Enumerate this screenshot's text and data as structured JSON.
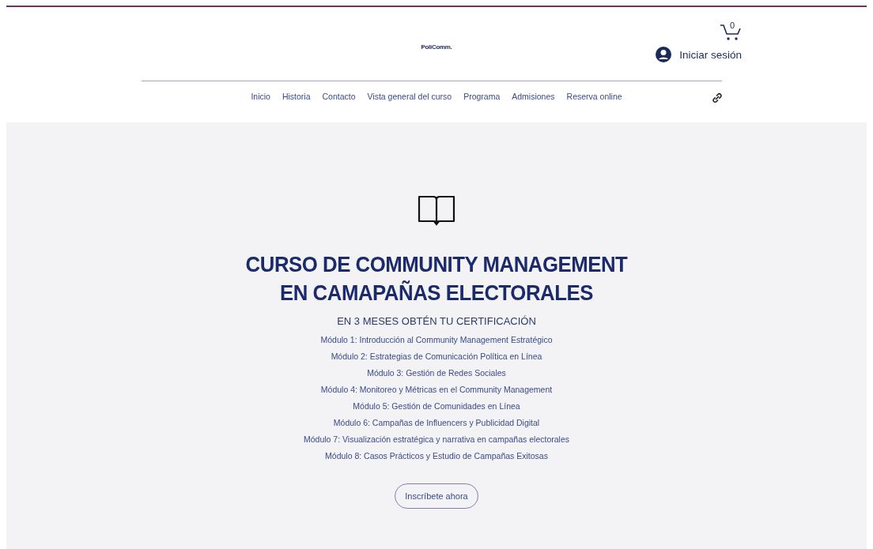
{
  "header": {
    "logo": "PoliComm.",
    "cart_count": "0",
    "login": "Iniciar sesión"
  },
  "nav": [
    {
      "label": "Inicio"
    },
    {
      "label": "Historia"
    },
    {
      "label": "Contacto"
    },
    {
      "label": "Vista general del curso"
    },
    {
      "label": "Programa"
    },
    {
      "label": "Admisiones"
    },
    {
      "label": "Reserva online"
    }
  ],
  "hero": {
    "title": "CURSO DE COMMUNITY MANAGEMENT EN CAMAPAÑAS ELECTORALES",
    "subtitle": "EN 3 MESES OBTÉN TU CERTIFICACIÓN",
    "modules": [
      "Módulo 1: Introducción al Community Management Estratégico",
      "Módulo 2: Estrategias de Comunicación Política en Línea",
      "Módulo 3: Gestión de Redes Sociales",
      "Módulo 4: Monitoreo y Métricas en el Community Management",
      "Módulo 5: Gestión de Comunidades en Línea",
      "Módulo 6: Campañas de Influencers y Publicidad Digital",
      "Módulo 7: Visualización estratégica y narrativa en campañas electorales",
      "Módulo 8: Casos Prácticos y Estudio de Campañas Exitosas"
    ],
    "button": "Inscríbete ahora"
  }
}
